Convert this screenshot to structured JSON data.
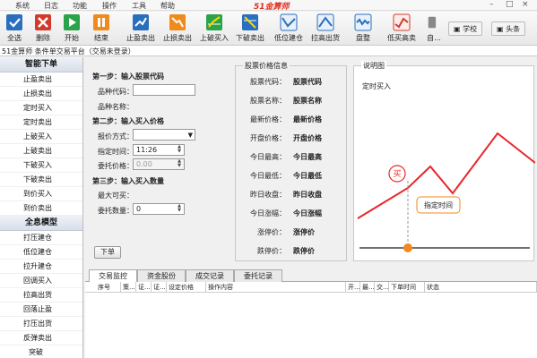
{
  "menubar": {
    "items": [
      "系统",
      "日志",
      "功能",
      "操作",
      "工具",
      "帮助"
    ],
    "logo": "51金算师",
    "controls": [
      "–",
      "□",
      "×"
    ]
  },
  "toolbar": {
    "buttons": [
      {
        "label": "全选",
        "icon": "select-all-icon",
        "color": "#2a6fbd"
      },
      {
        "label": "删除",
        "icon": "delete-icon",
        "color": "#d23b2b"
      },
      {
        "label": "开始",
        "icon": "play-icon",
        "color": "#2aa34a"
      },
      {
        "label": "结束",
        "icon": "pause-icon",
        "color": "#f08a1c"
      },
      {
        "label": "止盈卖出",
        "icon": "take-profit-icon",
        "color": "#2a6fbd"
      },
      {
        "label": "止损卖出",
        "icon": "stop-loss-icon",
        "color": "#f08a1c"
      },
      {
        "label": "上破买入",
        "icon": "breakout-up-icon",
        "color": "#2aa34a"
      },
      {
        "label": "下破卖出",
        "icon": "breakout-down-icon",
        "color": "#2a6fbd"
      },
      {
        "label": "低位建仓",
        "icon": "low-build-icon",
        "color": "#2a6fbd"
      },
      {
        "label": "拉高出货",
        "icon": "pull-up-sell-icon",
        "color": "#2a6fbd"
      },
      {
        "label": "盘整",
        "icon": "consolidate-icon",
        "color": "#2a6fbd"
      },
      {
        "label": "低买高卖",
        "icon": "buy-low-sell-high-icon",
        "color": "#d23b2b"
      },
      {
        "label": "自...",
        "icon": "custom-icon",
        "color": "#555555"
      }
    ],
    "right_buttons": [
      {
        "label": "学校",
        "icon": "school-icon"
      },
      {
        "label": "头条",
        "icon": "news-icon"
      }
    ]
  },
  "window_title": "51金算师 条件单交易平台（交易未登录）",
  "sidebar": {
    "section1_title": "智能下单",
    "section1_items": [
      "止盈卖出",
      "止损卖出",
      "定时买入",
      "定时卖出",
      "上破买入",
      "上破卖出",
      "下破买入",
      "下破卖出",
      "到价买入",
      "到价卖出"
    ],
    "section2_title": "全息模型",
    "section2_items": [
      "打压建仓",
      "低位建仓",
      "拉升建仓",
      "回调买入",
      "拉高出货",
      "回落止盈",
      "打压出货",
      "反弹卖出",
      "突破"
    ]
  },
  "order_form": {
    "step1": "第一步：输入股票代码",
    "code_label": "品种代码：",
    "code_value": "",
    "name_label": "品种名称：",
    "step2": "第二步：输入买入价格",
    "price_mode_label": "报价方式：",
    "price_mode_value": "",
    "time_label": "指定时间：",
    "time_value": "11:26",
    "price_label": "委托价格：",
    "price_value": "0.00",
    "step3": "第三步：输入买入数量",
    "max_label": "最大可买：",
    "qty_label": "委托数量：",
    "qty_value": "0",
    "submit": "下单"
  },
  "price_info": {
    "title": "股票价格信息",
    "rows": [
      {
        "label": "股票代码：",
        "value": "股票代码"
      },
      {
        "label": "股票名称：",
        "value": "股票名称"
      },
      {
        "label": "最新价格：",
        "value": "最新价格"
      },
      {
        "label": "开盘价格：",
        "value": "开盘价格"
      },
      {
        "label": "今日最高：",
        "value": "今日最高"
      },
      {
        "label": "今日最低：",
        "value": "今日最低"
      },
      {
        "label": "昨日收盘：",
        "value": "昨日收盘"
      },
      {
        "label": "今日涨幅：",
        "value": "今日涨幅"
      },
      {
        "label": "涨停价：",
        "value": "涨停价"
      },
      {
        "label": "跌停价：",
        "value": "跌停价"
      }
    ]
  },
  "explain": {
    "title": "说明图",
    "subtitle": "定时买入",
    "buy_tag": "买",
    "time_tag": "指定时间",
    "line_color": "#e8262a"
  },
  "tabs": [
    "交易监控",
    "资金股份",
    "成交记录",
    "委托记录"
  ],
  "grid_columns": [
    "序号",
    "策...",
    "证...",
    "证...",
    "设定价格",
    "操作内容",
    "开...",
    "最...",
    "交...",
    "下单时间",
    "状态"
  ]
}
